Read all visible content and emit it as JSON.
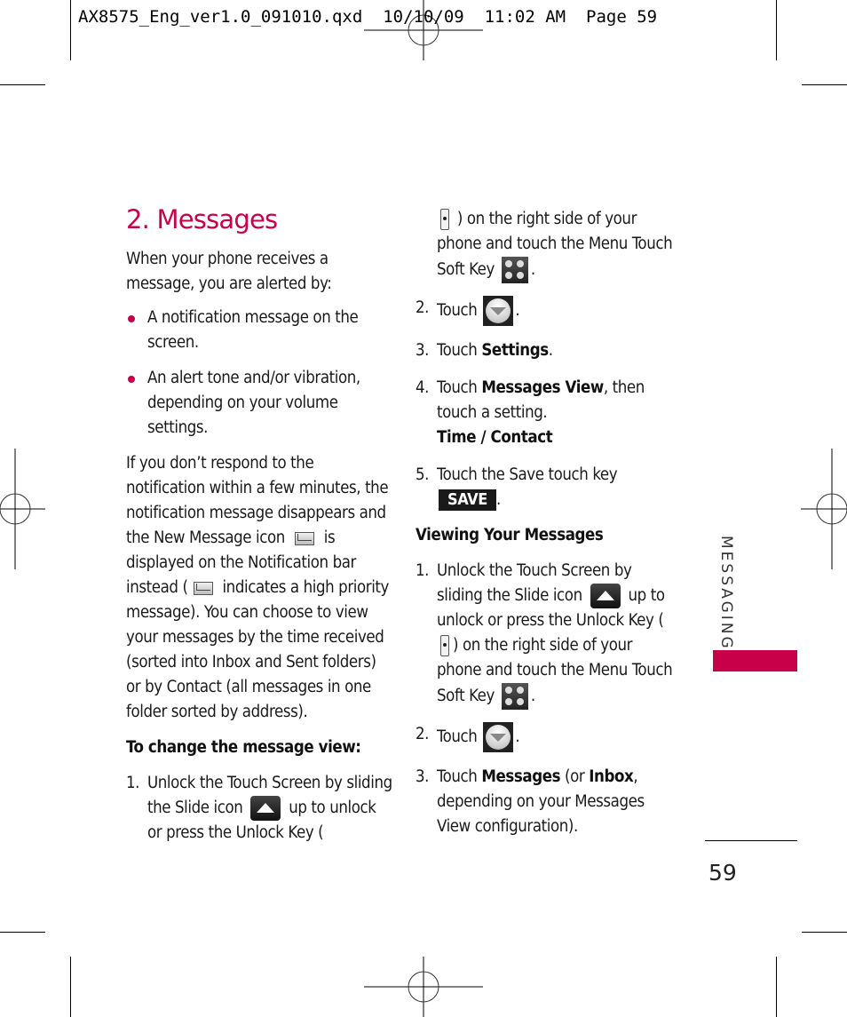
{
  "slug": {
    "file": "AX8575_Eng_ver1.0_091010.qxd",
    "date": "10/10/09",
    "time": "11:02 AM",
    "page_label": "Page 59"
  },
  "title": "2. Messages",
  "intro": "When your phone receives a message, you are alerted by:",
  "bullets": [
    "A notification message on the screen.",
    "An alert tone and/or vibration, depending on your volume settings."
  ],
  "para": {
    "part1": "If you don’t respond to the notification within a few minutes, the notification message disappears and the New Message icon",
    "part2": "is displayed on the Notification bar instead (",
    "part3": "indicates a high priority message). You can choose to view your messages by the time received (sorted into Inbox and Sent folders) or by Contact (all messages in one folder sorted by address)."
  },
  "change_view": {
    "heading": "To change the message view:",
    "steps": [
      {
        "num": "1.",
        "a": "Unlock the Touch Screen by sliding the Slide icon",
        "b": "up to unlock or press the Unlock Key (",
        "c": ") on the right side of your phone and touch the Menu Touch Soft Key",
        "d": "."
      },
      {
        "num": "2.",
        "a": "Touch",
        "d": "."
      },
      {
        "num": "3.",
        "a": "Touch",
        "bold": "Settings",
        "d": "."
      },
      {
        "num": "4.",
        "a": "Touch",
        "bold": "Messages View",
        "c": ", then touch a setting.",
        "option": "Time / Contact"
      },
      {
        "num": "5.",
        "a": "Touch the Save touch key",
        "button": "SAVE",
        "d": "."
      }
    ]
  },
  "viewing": {
    "heading": "Viewing Your Messages",
    "steps": [
      {
        "num": "1.",
        "a": "Unlock the Touch Screen by sliding the Slide icon",
        "b": "up to unlock or press the Unlock Key (",
        "c": ") on the right side of your phone and touch the Menu Touch Soft Key",
        "d": "."
      },
      {
        "num": "2.",
        "a": "Touch",
        "d": "."
      },
      {
        "num": "3.",
        "a": "Touch",
        "bold": "Messages",
        "mid": " (or ",
        "bold2": "Inbox",
        "c": ", depending on your Messages View configuration)."
      }
    ]
  },
  "side_tab": "MESSAGING",
  "page_number": "59",
  "colors": {
    "accent": "#c8004a"
  }
}
